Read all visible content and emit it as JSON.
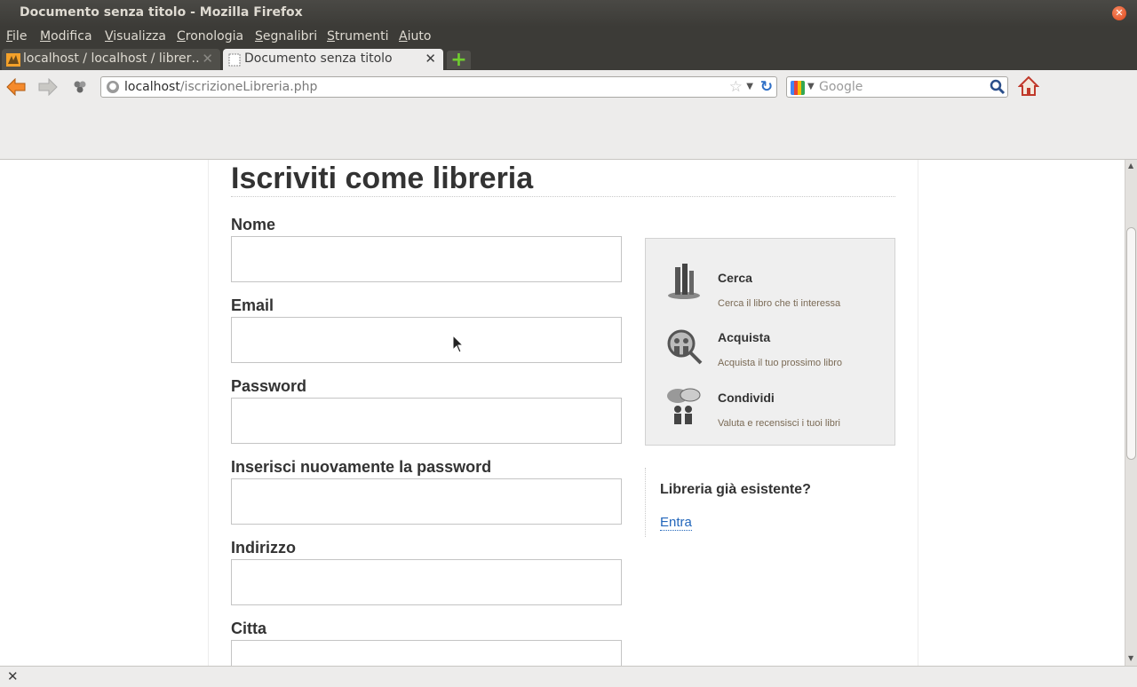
{
  "window": {
    "title": "Documento senza titolo - Mozilla Firefox",
    "close_symbol": "✕"
  },
  "menubar": {
    "items": [
      "File",
      "Modifica",
      "Visualizza",
      "Cronologia",
      "Segnalibri",
      "Strumenti",
      "Aiuto"
    ]
  },
  "tabs": [
    {
      "label": "localhost / localhost / librer…",
      "active": false,
      "icon": "phpmyadmin-icon"
    },
    {
      "label": "Documento senza titolo",
      "active": true,
      "icon": "blank-page-icon"
    }
  ],
  "tab_close_symbol": "✕",
  "new_tab_symbol": "+",
  "navigation": {
    "back_icon": "back-arrow-icon",
    "forward_icon": "forward-arrow-icon",
    "url_host": "localhost",
    "url_path": "/iscrizioneLibreria.php",
    "search_placeholder": "Google"
  },
  "page": {
    "heading": "Iscriviti come libreria",
    "fields": [
      {
        "label": "Nome",
        "value": ""
      },
      {
        "label": "Email",
        "value": ""
      },
      {
        "label": "Password",
        "value": ""
      },
      {
        "label": "Inserisci nuovamente la password",
        "value": ""
      },
      {
        "label": "Indirizzo",
        "value": ""
      },
      {
        "label": "Citta",
        "value": ""
      }
    ],
    "features": [
      {
        "title": "Cerca",
        "description": "Cerca il libro che ti interessa",
        "icon": "books-icon"
      },
      {
        "title": "Acquista",
        "description": "Acquista il tuo prossimo libro",
        "icon": "magnifier-people-icon"
      },
      {
        "title": "Condividi",
        "description": "Valuta e recensisci i tuoi libri",
        "icon": "speech-people-icon"
      }
    ],
    "existing": {
      "question": "Libreria già esistente?",
      "link": "Entra"
    }
  },
  "colors": {
    "title_bar": "#3c3b37",
    "link": "#2266bb",
    "heading": "#333333",
    "sidebox_bg": "#efefef"
  }
}
